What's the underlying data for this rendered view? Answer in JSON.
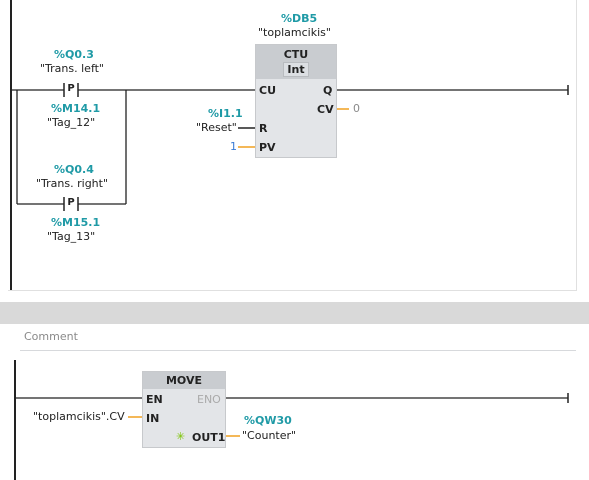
{
  "network1": {
    "db_address": "%DB5",
    "db_name": "\"toplamcikis\"",
    "contact1": {
      "address": "%Q0.3",
      "tag": "\"Trans. left\"",
      "type": "P",
      "mem_address": "%M14.1",
      "mem_tag": "\"Tag_12\""
    },
    "contact2": {
      "address": "%Q0.4",
      "tag": "\"Trans. right\"",
      "type": "P",
      "mem_address": "%M15.1",
      "mem_tag": "\"Tag_13\""
    },
    "ctu": {
      "title": "CTU",
      "data_type": "Int",
      "pin_cu": "CU",
      "pin_r": "R",
      "pin_pv": "PV",
      "pin_q": "Q",
      "pin_cv": "CV",
      "cv_value": "0",
      "pv_value": "1",
      "reset_address": "%I1.1",
      "reset_tag": "\"Reset\""
    }
  },
  "comment": {
    "placeholder": "Comment"
  },
  "network2": {
    "move": {
      "title": "MOVE",
      "pin_en": "EN",
      "pin_eno": "ENO",
      "pin_in": "IN",
      "pin_out": "OUT1",
      "in_operand": "\"toplamcikis\".CV",
      "out_address": "%QW30",
      "out_tag": "\"Counter\""
    }
  },
  "colors": {
    "address": "#1f9aa6",
    "wire": "#222222",
    "param_wire": "#f0a020",
    "value_gray": "#8a8a8a",
    "value_blue": "#3a7bd5",
    "box_fill": "#e3e5e8",
    "box_header": "#c9ccd0",
    "separator": "#d9d9d9"
  }
}
